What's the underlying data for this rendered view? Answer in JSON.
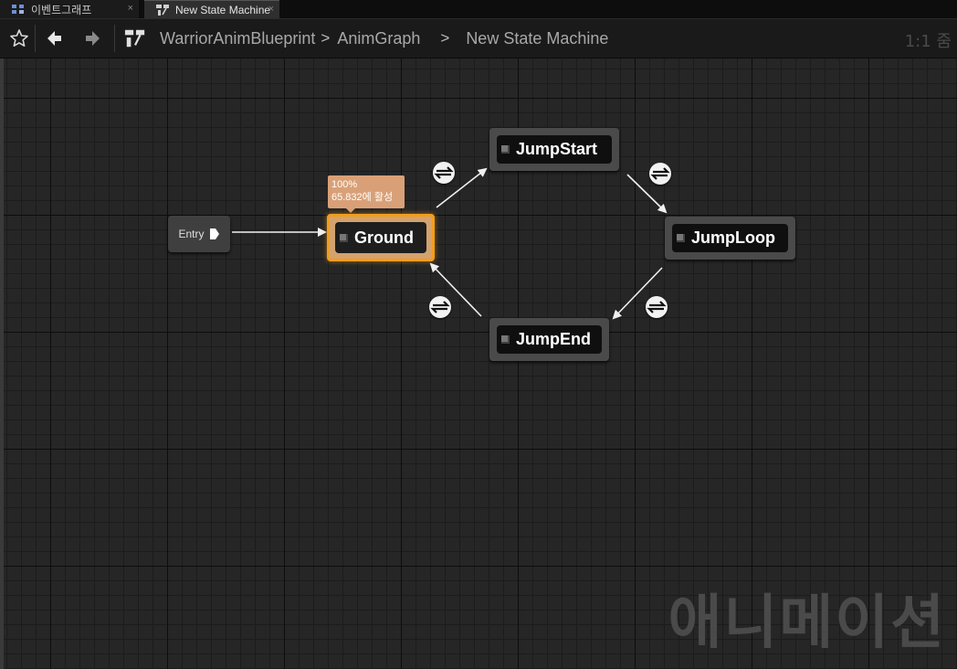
{
  "tabs": [
    {
      "label": "이벤트그래프",
      "icon": "event-graph-icon",
      "close": "×",
      "active": false
    },
    {
      "label": "New State Machine",
      "icon": "state-machine-icon",
      "close": "×",
      "active": true
    }
  ],
  "toolbar": {
    "breadcrumbs": [
      "WarriorAnimBlueprint",
      "AnimGraph",
      "New State Machine"
    ],
    "separator": ">",
    "zoom": "1:1 줌"
  },
  "graph": {
    "entry_label": "Entry",
    "states": {
      "ground": {
        "label": "Ground",
        "active": true
      },
      "jump_start": {
        "label": "JumpStart"
      },
      "jump_loop": {
        "label": "JumpLoop"
      },
      "jump_end": {
        "label": "JumpEnd"
      }
    },
    "active_tooltip": {
      "weight": "100%",
      "time": "65.832에 활성"
    },
    "transitions": [
      {
        "from": "Entry",
        "to": "Ground"
      },
      {
        "from": "Ground",
        "to": "JumpStart"
      },
      {
        "from": "JumpStart",
        "to": "JumpLoop"
      },
      {
        "from": "JumpLoop",
        "to": "JumpEnd"
      },
      {
        "from": "JumpEnd",
        "to": "Ground"
      }
    ],
    "watermark": "애니메이션"
  },
  "colors": {
    "active_border": "#f29d1c",
    "active_fill": "#d3a26e",
    "tooltip": "#d9a077",
    "node_bg": "#4a4a4a",
    "canvas": "#262626"
  }
}
